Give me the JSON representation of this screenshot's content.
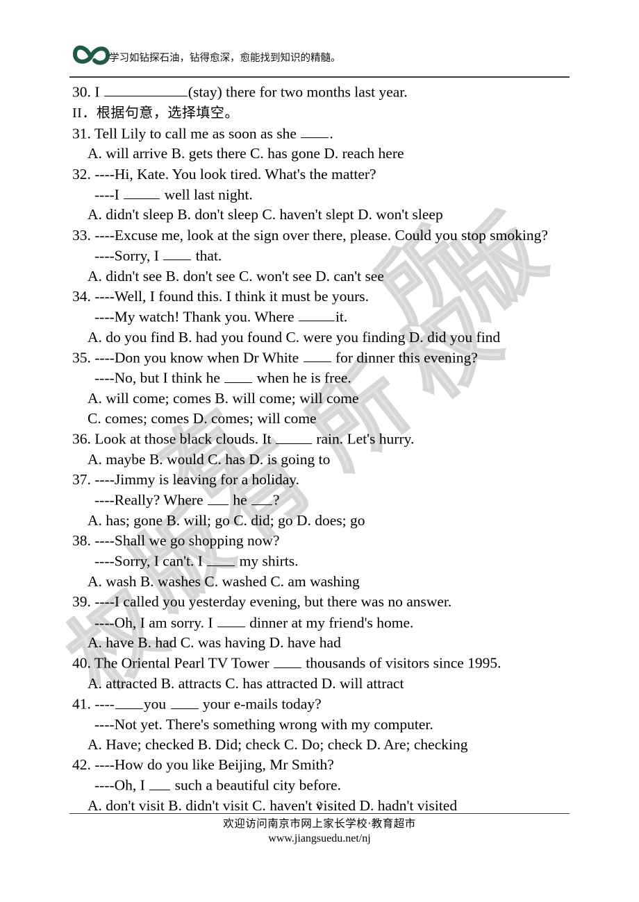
{
  "header": {
    "logo_name": "infinity-logo",
    "logo_color": "#1f5b43",
    "tagline": "学习如钻探石油，钻得愈深，愈能找到知识的精髓。"
  },
  "watermark": {
    "text": "版权所有",
    "color": "#d6d6d6",
    "chars": [
      "版",
      "权",
      "所",
      "有",
      "版",
      "权",
      "所",
      "有"
    ]
  },
  "content": {
    "q30": {
      "num": "30. ",
      "pre": "I ",
      "post": "(stay) there for two months last year."
    },
    "section2": {
      "roman": "II",
      "rest": "．根据句意，选择填空。"
    },
    "q31": {
      "num": "31. ",
      "stem_pre": "Tell Lily to call me as soon as she ",
      "stem_post": ".",
      "options": "A. will arrive      B. gets there      C. has gone      D. reach here"
    },
    "q32": {
      "num": "32. ",
      "stem": "----Hi, Kate. You look tired. What's the matter?",
      "reply_pre": "----I ",
      "reply_post": " well last night.",
      "options": "A. didn't sleep      B. don't sleep      C. haven't slept      D. won't sleep"
    },
    "q33": {
      "num": "33. ",
      "stem": "----Excuse me, look at the sign over there, please. Could you stop smoking?",
      "reply_pre": "----Sorry, I ",
      "reply_post": " that.",
      "options": "A. didn't see      B. don't see      C. won't see      D. can't see"
    },
    "q34": {
      "num": "34. ",
      "stem": "----Well, I found this. I think it must be yours.",
      "reply_pre": "----My watch! Thank you. Where ",
      "reply_post": "it.",
      "options": "A. do you find      B. had you found      C. were you finding      D. did you find"
    },
    "q35": {
      "num": "35. ",
      "stem_pre": "----Don you know when Dr White ",
      "stem_post": " for dinner this evening?",
      "reply_pre": "----No, but I think he ",
      "reply_post": " when he is free.",
      "options_1": "A. will come; comes      B. will come; will come",
      "options_2": "C. comes; comes      D. comes; will come"
    },
    "q36": {
      "num": "36. ",
      "stem_pre": "Look at those black clouds. It ",
      "stem_post": " rain. Let's hurry.",
      "options": "A. maybe      B. would      C. has      D. is going to"
    },
    "q37": {
      "num": "37. ",
      "stem": "----Jimmy is leaving for a holiday.",
      "reply_pre": "----Really? Where ",
      "reply_mid": " he ",
      "reply_post": "?",
      "options": "A. has; gone      B. will; go      C. did; go      D. does; go"
    },
    "q38": {
      "num": "38. ",
      "stem": "----Shall we go shopping now?",
      "reply_pre": "----Sorry, I can't. I ",
      "reply_post": " my shirts.",
      "options": "A. wash      B. washes      C. washed      C. am washing"
    },
    "q39": {
      "num": "39. ",
      "stem": "----I called you yesterday evening, but there was no answer.",
      "reply_pre": "----Oh, I am sorry. I ",
      "reply_post": " dinner at my friend's home.",
      "options": "A. have      B. had      C. was having      D. have had"
    },
    "q40": {
      "num": "40. ",
      "stem_pre": "The Oriental Pearl TV Tower ",
      "stem_post": " thousands of visitors since 1995.",
      "options": "A. attracted      B. attracts      C. has attracted      D. will attract"
    },
    "q41": {
      "num": "41. ",
      "stem_pre": "----",
      "stem_mid": "you ",
      "stem_post": " your e-mails today?",
      "reply": "----Not yet. There's something wrong with my computer.",
      "options": "A. Have; checked      B. Did; check      C. Do; check      D. Are; checking"
    },
    "q42": {
      "num": "42. ",
      "stem": "----How do you like Beijing, Mr Smith?",
      "reply_pre": "----Oh, I ",
      "reply_post": " such a beautiful city before.",
      "options": "A. don't visit      B. didn't visit      C. haven't visited      D. hadn't visited"
    }
  },
  "footer": {
    "page_number": "2",
    "site_name": "欢迎访问南京市网上家长学校·教育超市",
    "url": "www.jiangsuedu.net/nj"
  }
}
